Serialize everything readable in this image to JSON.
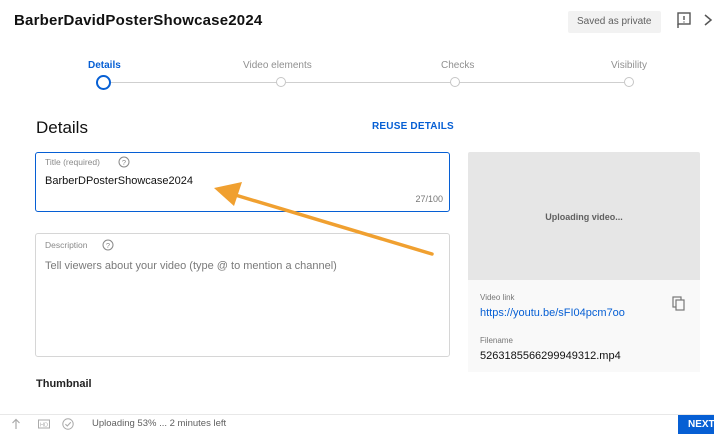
{
  "header": {
    "title": "BarberDavidPosterShowcase2024",
    "saved_badge": "Saved as private"
  },
  "stepper": {
    "steps": [
      {
        "label": "Details",
        "active": true
      },
      {
        "label": "Video elements",
        "active": false
      },
      {
        "label": "Checks",
        "active": false
      },
      {
        "label": "Visibility",
        "active": false
      }
    ]
  },
  "details": {
    "section_title": "Details",
    "reuse_label": "REUSE DETAILS",
    "title_field": {
      "label": "Title (required)",
      "value": "BarberDPosterShowcase2024",
      "counter": "27/100"
    },
    "description_field": {
      "label": "Description",
      "placeholder": "Tell viewers about your video (type @ to mention a channel)"
    },
    "thumbnail_title": "Thumbnail"
  },
  "side_panel": {
    "status": "Uploading video...",
    "video_link_label": "Video link",
    "video_link": "https://youtu.be/sFI04pcm7oo",
    "filename_label": "Filename",
    "filename": "5263185566299949312.mp4"
  },
  "footer": {
    "status": "Uploading 53% ... 2 minutes left",
    "progress_percent": 53,
    "next_label": "NEXT"
  },
  "colors": {
    "accent": "#065fd4",
    "arrow": "#f0a030"
  }
}
